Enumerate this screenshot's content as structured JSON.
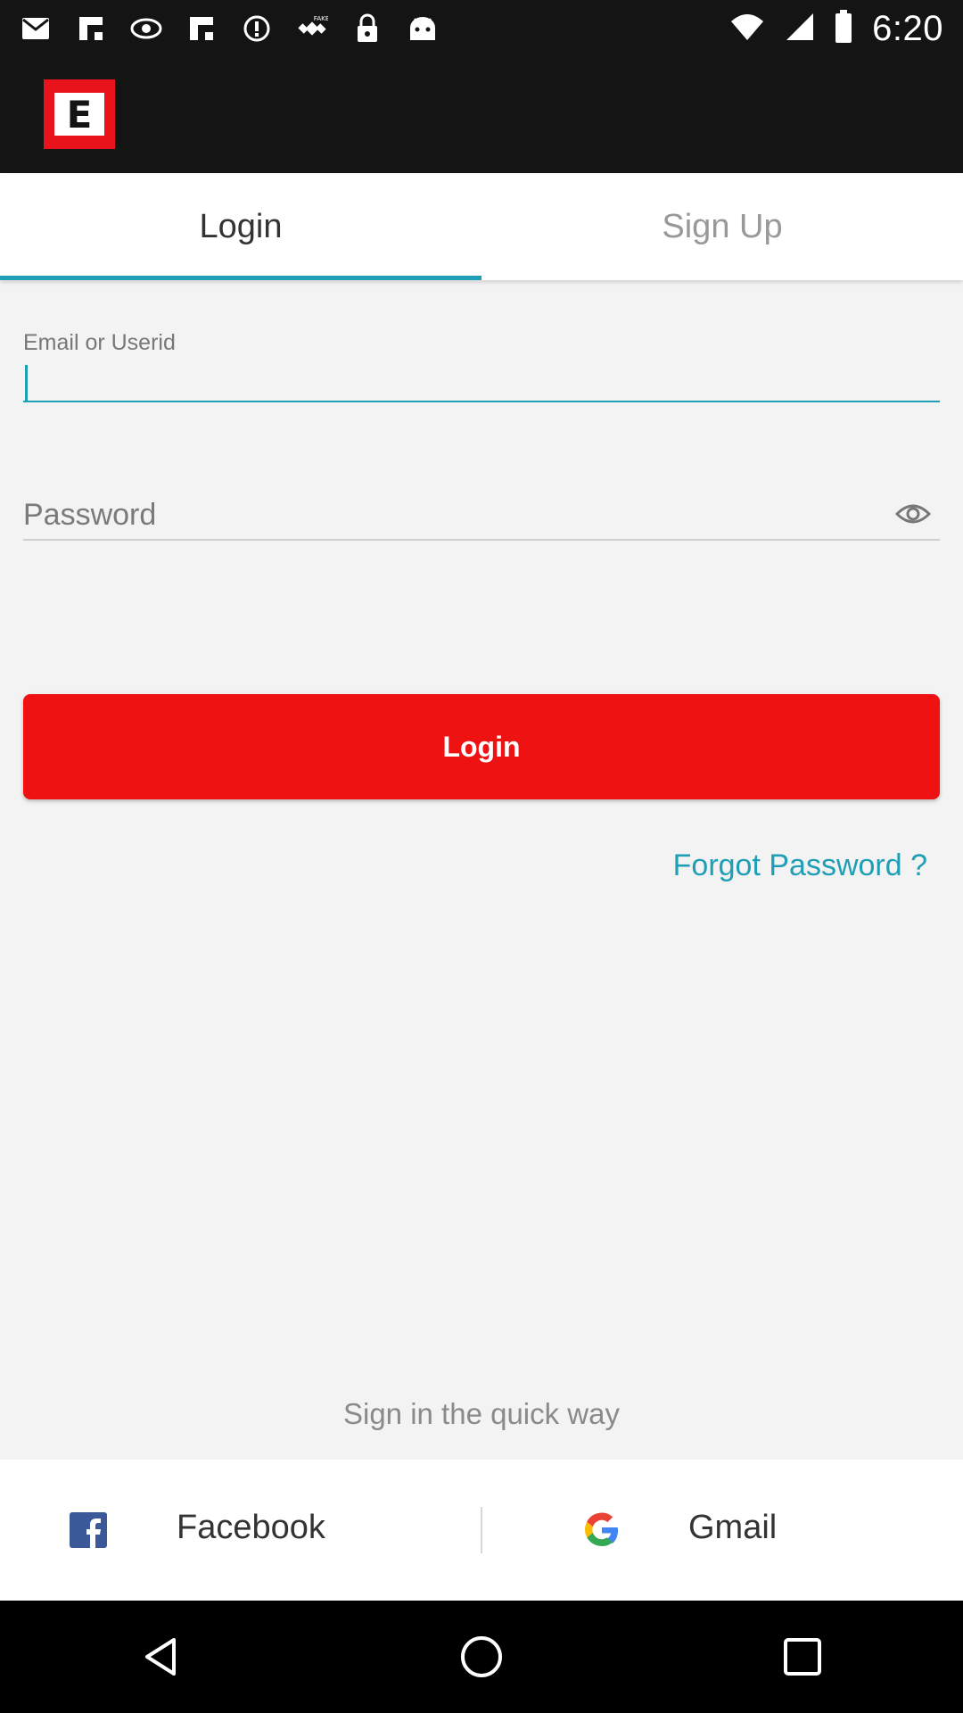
{
  "status_bar": {
    "time": "6:20",
    "icons": [
      "email-icon",
      "flipboard-icon",
      "eye-icon",
      "flipboard-icon",
      "info-icon",
      "fake-gps-icon",
      "lock-icon",
      "android-icon"
    ],
    "right_icons": [
      "wifi-icon",
      "signal-icon",
      "battery-icon"
    ]
  },
  "app_bar": {
    "logo_letter": "E",
    "logo_color": "#e8131b"
  },
  "tabs": [
    {
      "label": "Login",
      "active": true
    },
    {
      "label": "Sign Up",
      "active": false
    }
  ],
  "form": {
    "email_label": "Email or Userid",
    "email_value": "",
    "password_placeholder": "Password",
    "login_label": "Login",
    "forgot_label": "Forgot Password ?"
  },
  "quick": {
    "heading": "Sign in the quick way",
    "facebook_label": "Facebook",
    "gmail_label": "Gmail"
  },
  "colors": {
    "accent": "#1f9fb5",
    "button": "#ee1212"
  }
}
